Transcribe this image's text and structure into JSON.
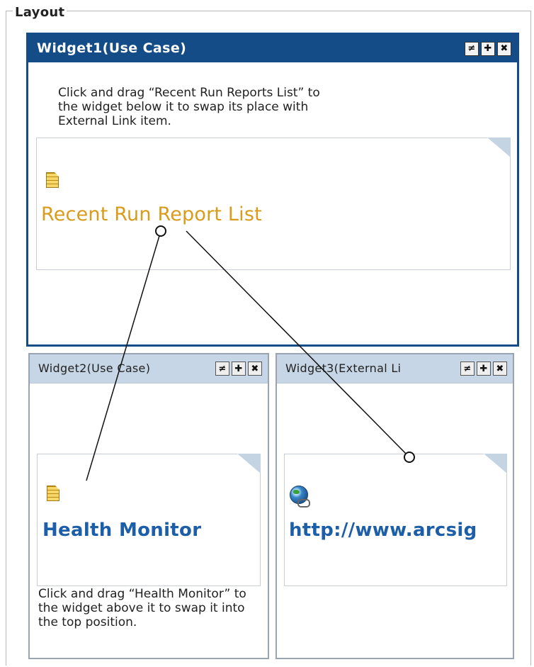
{
  "layout": {
    "legend": "Layout"
  },
  "widgets": {
    "w1": {
      "title": "Widget1(Use Case)",
      "instruction": "Click and drag “Recent Run Reports List” to the widget below it to swap its place with External Link item.",
      "card_title": "Recent Run Report List",
      "tools": [
        "≠",
        "✚",
        "✖"
      ]
    },
    "w2": {
      "title": "Widget2(Use Case)",
      "card_title": "Health Monitor",
      "instruction": "Click and drag “Health Monitor” to the widget above it to swap it into the top position.",
      "tools": [
        "≠",
        "✚",
        "✖"
      ]
    },
    "w3": {
      "title": "Widget3(External Li",
      "card_title": "http://www.arcsig",
      "tools": [
        "≠",
        "✚",
        "✖"
      ]
    }
  },
  "icons": {
    "report": "report-icon",
    "link": "external-link-icon",
    "tool_collapse": "collapse-icon",
    "tool_move": "move-icon",
    "tool_close": "close-icon"
  },
  "colors": {
    "active_header": "#134c86",
    "inactive_header": "#c7d6e6",
    "report_title": "#d99b1a",
    "link_title": "#1d5ea8"
  }
}
